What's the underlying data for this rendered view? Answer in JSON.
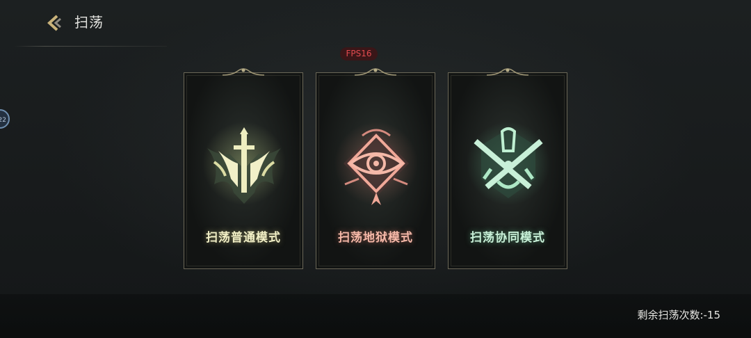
{
  "header": {
    "title": "扫荡"
  },
  "fps_badge": "FPS16",
  "side_badge": "22",
  "modes": [
    {
      "label": "扫荡普通模式",
      "color": "#f1efc6",
      "icon": "sword-crest-emblem"
    },
    {
      "label": "扫荡地狱模式",
      "color": "#f5b8a8",
      "icon": "eye-crest-emblem"
    },
    {
      "label": "扫荡协同模式",
      "color": "#c8f0d8",
      "icon": "crossed-swords-emblem"
    }
  ],
  "footer": {
    "remaining_label": "剩余扫荡次数:",
    "remaining_value": "-15"
  }
}
